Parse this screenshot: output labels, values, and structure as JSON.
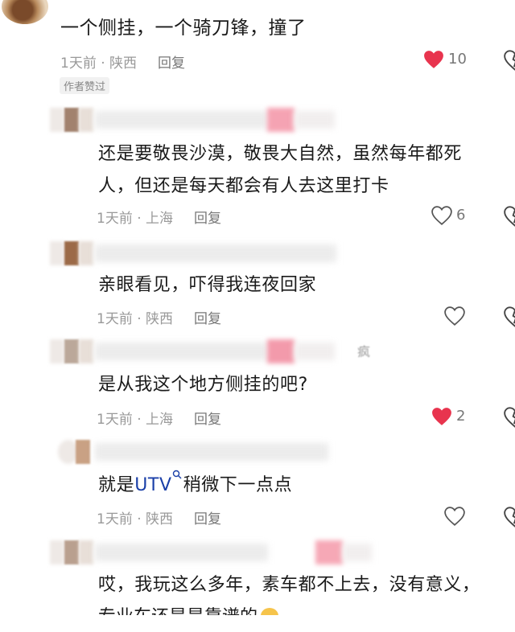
{
  "comment": {
    "text": "一个侧挂，一个骑刀锋，撞了",
    "time": "1天前 · 陕西",
    "reply_label": "回复",
    "likes": "10",
    "liked": true,
    "badge": "作者赞过"
  },
  "replies": [
    {
      "text1": "还是要敬畏沙漠，敬畏大自然，虽然每年都死",
      "text2": "人，但还是每天都会有人去这里打卡",
      "time": "1天前 · 上海",
      "reply_label": "回复",
      "likes": "6",
      "liked": false
    },
    {
      "text1": "亲眼看见，吓得我连夜回家",
      "time": "1天前 · 陕西",
      "reply_label": "回复",
      "likes": "",
      "liked": false
    },
    {
      "text1": "是从我这个地方侧挂的吧?",
      "time": "1天前 · 上海",
      "reply_label": "回复",
      "likes": "2",
      "liked": true,
      "name_tail": "疯"
    },
    {
      "text_before": "就是",
      "link": "UTV",
      "text_after": "稍微下一点点",
      "time": "1天前 · 陕西",
      "reply_label": "回复",
      "likes": "",
      "liked": false
    },
    {
      "text1": "哎，我玩这么多年，素车都不上去，没有意义，",
      "text2": "专业车还是是靠谱的"
    }
  ],
  "colors": {
    "like_red": "#e8344e",
    "meta_gray": "#999999",
    "link_blue": "#1a3fa8"
  },
  "icons": [
    "heart-icon",
    "heart-outline-icon",
    "search-icon",
    "emoji-icon"
  ]
}
